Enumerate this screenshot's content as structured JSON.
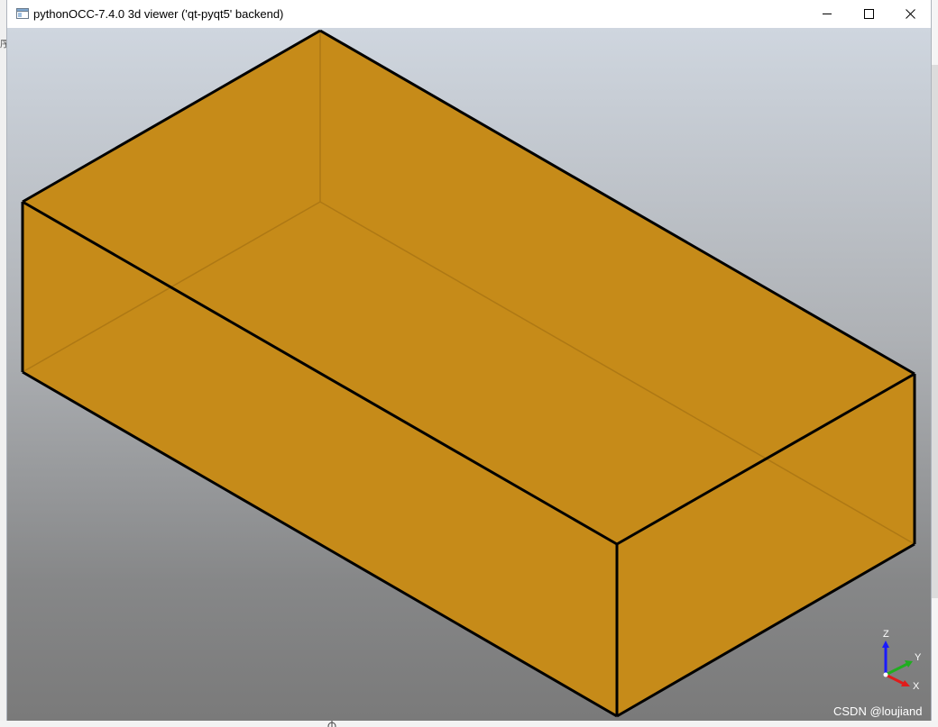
{
  "window": {
    "title": "pythonOCC-7.4.0 3d viewer ('qt-pyqt5' backend)",
    "icon": "qt-window-icon",
    "controls": {
      "minimize": "minimize-icon",
      "maximize": "maximize-icon",
      "close": "close-icon"
    }
  },
  "viewport": {
    "background_top": "#cfd6df",
    "background_bottom": "#7a7a7a",
    "shape": {
      "type": "box",
      "face_color": "#c68b19",
      "edge_color": "#000000"
    },
    "triedron": {
      "z_label": "Z",
      "y_label": "Y",
      "x_label": "X",
      "z_color": "#1a1aff",
      "y_color": "#1fae1f",
      "x_color": "#e01b1b"
    }
  },
  "watermark": "CSDN @loujiand",
  "background_app": {
    "left_glyph": "序"
  }
}
